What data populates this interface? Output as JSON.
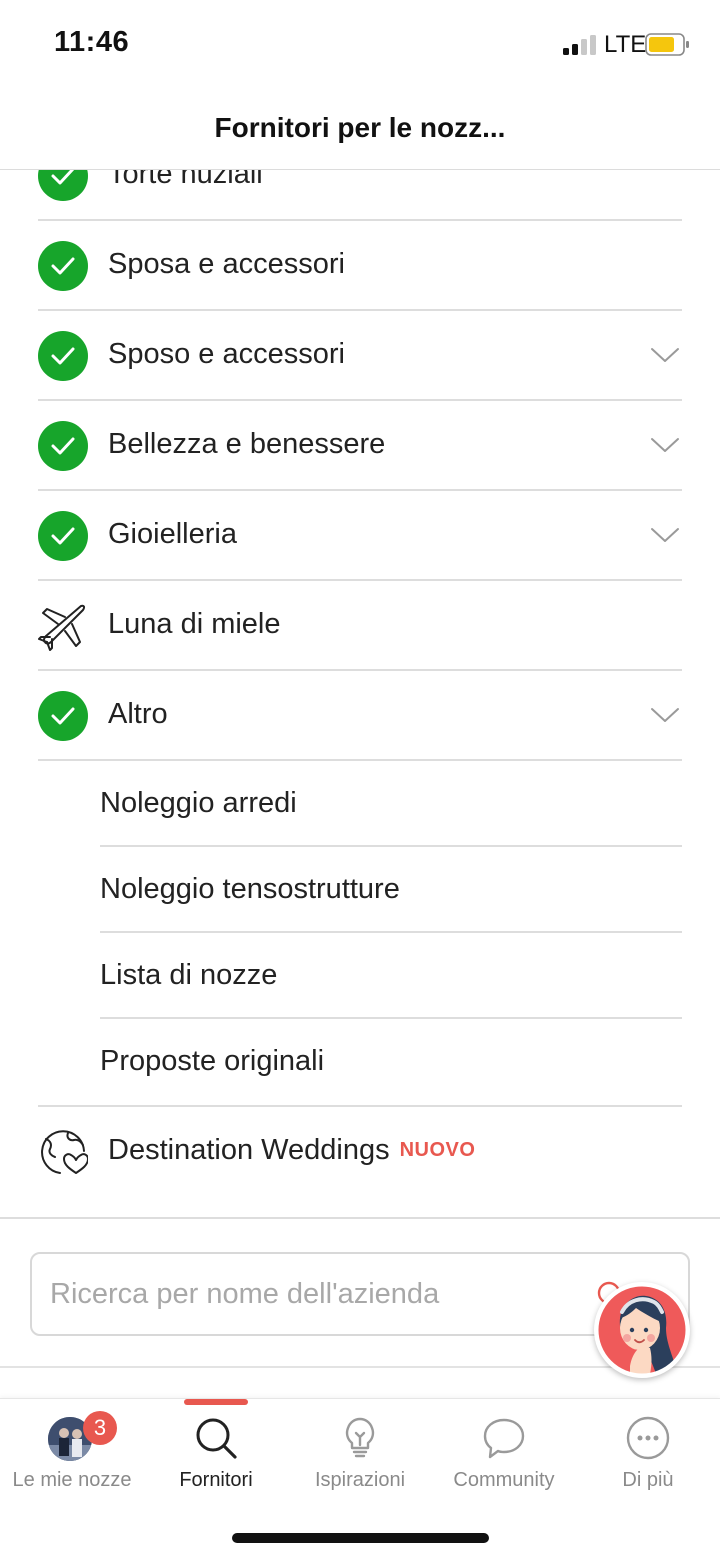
{
  "status_bar": {
    "time": "11:46",
    "carrier": "LTE"
  },
  "header": {
    "title": "Fornitori per le nozz..."
  },
  "categories": [
    {
      "label": "Torte nuziali",
      "icon": "check-icon",
      "checked": true,
      "has_chevron": false
    },
    {
      "label": "Sposa e accessori",
      "icon": "check-icon",
      "checked": true,
      "has_chevron": false
    },
    {
      "label": "Sposo e accessori",
      "icon": "check-icon",
      "checked": true,
      "has_chevron": true
    },
    {
      "label": "Bellezza e benessere",
      "icon": "check-icon",
      "checked": true,
      "has_chevron": true
    },
    {
      "label": "Gioielleria",
      "icon": "check-icon",
      "checked": true,
      "has_chevron": true
    },
    {
      "label": "Luna di miele",
      "icon": "airplane-icon",
      "checked": false,
      "has_chevron": false
    },
    {
      "label": "Altro",
      "icon": "check-icon",
      "checked": true,
      "has_chevron": true
    }
  ],
  "subcategories": [
    {
      "label": "Noleggio arredi"
    },
    {
      "label": "Noleggio tensostrutture"
    },
    {
      "label": "Lista di nozze"
    },
    {
      "label": "Proposte originali"
    }
  ],
  "destination": {
    "label": "Destination Weddings",
    "badge": "NUOVO",
    "icon": "globe-heart-icon"
  },
  "search": {
    "placeholder": "Ricerca per nome dell'azienda"
  },
  "tabs": [
    {
      "label": "Le mie nozze",
      "icon": "avatar",
      "badge": "3",
      "active": false
    },
    {
      "label": "Fornitori",
      "icon": "search-icon",
      "active": true
    },
    {
      "label": "Ispirazioni",
      "icon": "lightbulb-icon",
      "active": false
    },
    {
      "label": "Community",
      "icon": "chat-bubble-icon",
      "active": false
    },
    {
      "label": "Di più",
      "icon": "more-icon",
      "active": false
    }
  ],
  "colors": {
    "accent": "#e8584f",
    "check_green": "#17a52b",
    "battery": "#f5c60d"
  }
}
